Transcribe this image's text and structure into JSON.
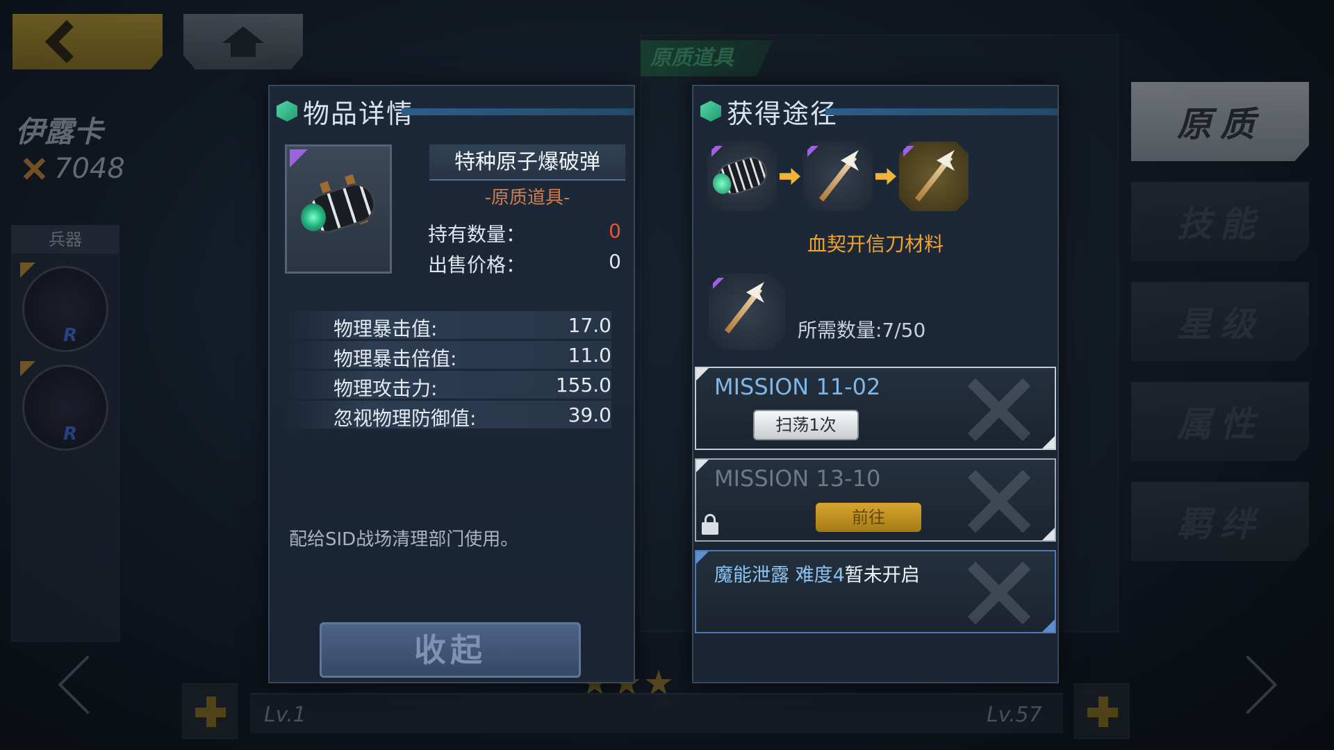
{
  "nav": {
    "back_icon": "chevron-left-icon",
    "home_icon": "home-icon"
  },
  "character": {
    "name": "伊露卡",
    "power": "7048"
  },
  "weapon_panel": {
    "title": "兵器",
    "slots": [
      {
        "grade": "R"
      },
      {
        "grade": "R"
      }
    ]
  },
  "background_tab": "原质道具",
  "side_tabs": [
    {
      "label": "原质",
      "active": true
    },
    {
      "label": "技能",
      "active": false
    },
    {
      "label": "星级",
      "active": false
    },
    {
      "label": "属性",
      "active": false
    },
    {
      "label": "羁绊",
      "active": false
    }
  ],
  "bottom": {
    "level_left": "Lv.1",
    "level_right": "Lv.57"
  },
  "detail": {
    "title": "物品详情",
    "item_name": "特种原子爆破弹",
    "item_type": "-原质道具-",
    "owned_label": "持有数量：",
    "owned_value": "0",
    "price_label": "出售价格：",
    "price_value": "0",
    "stats": [
      {
        "label": "物理暴击值:",
        "value": "17.0"
      },
      {
        "label": "物理暴击倍值:",
        "value": "11.0"
      },
      {
        "label": "物理攻击力:",
        "value": "155.0"
      },
      {
        "label": "忽视物理防御值:",
        "value": "39.0"
      }
    ],
    "description": "配给SID战场清理部门使用。",
    "collapse_label": "收起"
  },
  "obtain": {
    "title": "获得途径",
    "chain_label": "血契开信刀材料",
    "required_text": "所需数量:7/50",
    "missions": [
      {
        "title": "MISSION 11-02",
        "button": "扫荡1次",
        "locked": false
      },
      {
        "title": "MISSION 13-10",
        "button": "前往",
        "locked": true
      }
    ],
    "event": {
      "name": "魔能泄露",
      "difficulty": "难度4",
      "status": "暂未开启"
    }
  },
  "colors": {
    "accent_gold": "#efa42e",
    "mission_blue": "#7fb7e8",
    "owned_red": "#e8562e"
  }
}
